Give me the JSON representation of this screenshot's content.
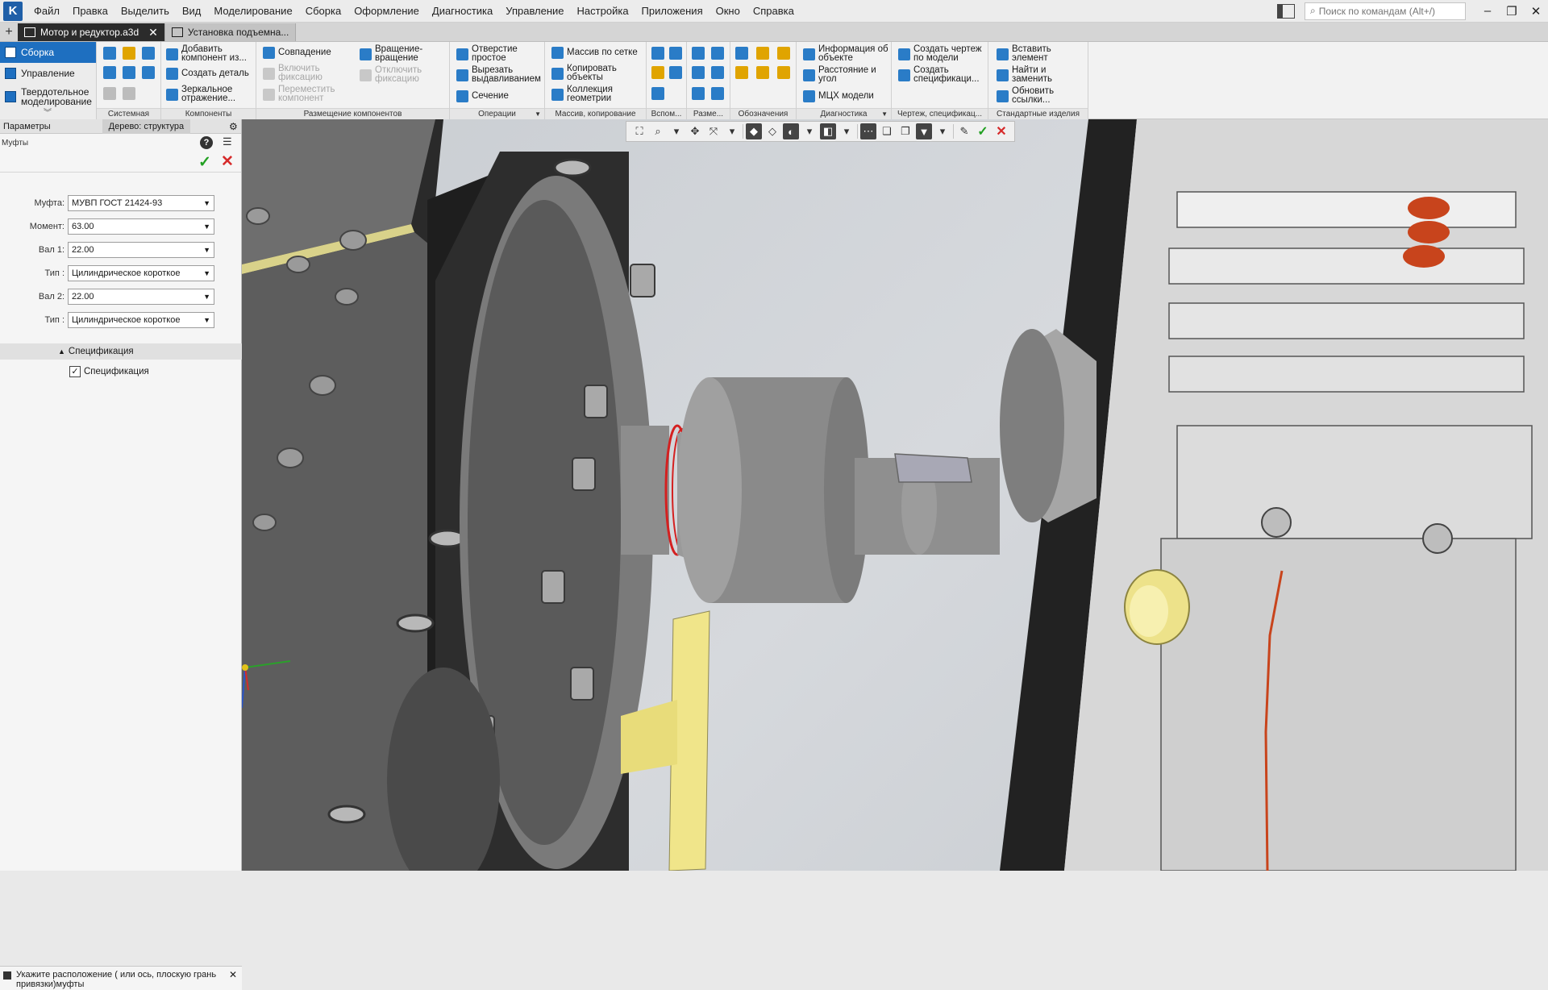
{
  "app": {
    "logo_letter": "K"
  },
  "menu": [
    "Файл",
    "Правка",
    "Выделить",
    "Вид",
    "Моделирование",
    "Сборка",
    "Оформление",
    "Диагностика",
    "Управление",
    "Настройка",
    "Приложения",
    "Окно",
    "Справка"
  ],
  "search": {
    "placeholder": "Поиск по командам (Alt+/)"
  },
  "tabs": [
    {
      "label": "Мотор и редуктор.a3d",
      "active": true
    },
    {
      "label": "Установка подъемна..."
    }
  ],
  "modes": [
    {
      "label": "Сборка",
      "active": true
    },
    {
      "label": "Управление"
    },
    {
      "label": "Твердотельное моделирование"
    }
  ],
  "ribbon": {
    "groups": [
      "Системная",
      "Компоненты",
      "Размещение компонентов",
      "Операции",
      "Массив, копирование",
      "Вспом...",
      "Разме...",
      "Обозначения",
      "Диагностика",
      "Чертеж, спецификац...",
      "Стандартные изделия"
    ],
    "components": {
      "add": "Добавить компонент из...",
      "create_part": "Создать деталь",
      "mirror": "Зеркальное отражение..."
    },
    "placement": {
      "coincidence": "Совпадение",
      "enable_fix": "Включить фиксацию",
      "move_component": "Переместить компонент",
      "rotation": "Вращение- вращение",
      "disable_fix": "Отключить фиксацию"
    },
    "operations": {
      "hole": "Отверстие простое",
      "cut_extrude": "Вырезать выдавливанием",
      "section": "Сечение"
    },
    "array": {
      "grid": "Массив по сетке",
      "copy": "Копировать объекты",
      "collection": "Коллекция геометрии"
    },
    "diagnostics": {
      "info": "Информация об объекте",
      "distance": "Расстояние и угол",
      "mass": "МЦХ модели"
    },
    "drawing": {
      "create_drawing": "Создать чертеж по модели",
      "create_spec": "Создать спецификаци..."
    },
    "standard": {
      "insert": "Вставить элемент",
      "find_replace": "Найти и заменить",
      "update_links": "Обновить ссылки..."
    }
  },
  "panel": {
    "tab_params": "Параметры",
    "tab_tree": "Дерево: структура",
    "subtitle": "Муфты",
    "fields": [
      {
        "label": "Муфта:",
        "value": "МУВП ГОСТ 21424-93"
      },
      {
        "label": "Момент:",
        "value": "63.00"
      },
      {
        "label": "Вал 1:",
        "value": "22.00"
      },
      {
        "label": "Тип :",
        "value": "Цилиндрическое короткое"
      },
      {
        "label": "Вал 2:",
        "value": "22.00"
      },
      {
        "label": "Тип :",
        "value": "Цилиндрическое короткое"
      }
    ],
    "spec_section": "Спецификация",
    "spec_checkbox": "Спецификация"
  },
  "status": {
    "message": "Укажите расположение ( или ось, плоскую грань привязки)муфты"
  },
  "colors": {
    "accent": "#1e6fc0",
    "confirm": "#22a022",
    "cancel": "#d62a2a",
    "bracket_yellow": "#f0e58a",
    "screw_red": "#c8441c"
  }
}
